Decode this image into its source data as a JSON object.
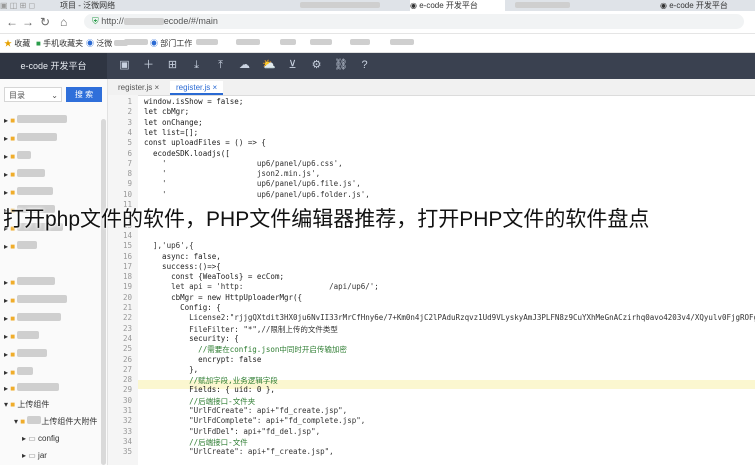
{
  "browser": {
    "tabs": [
      {
        "label": "项目 - 泛微网络",
        "active": false
      },
      {
        "label": "e-code 开发平台",
        "active": false
      },
      {
        "label": "e-code 开发平台",
        "active": true
      },
      {
        "label": "e-code 开发平台",
        "active": false
      }
    ],
    "url_prefix": "http://",
    "url_suffix": "ecode/#/main",
    "bookmarks": [
      "收藏",
      "手机收藏夹",
      "泛微",
      "部门工作"
    ]
  },
  "app": {
    "brand": "e-code 开发平台",
    "toolbar_icons": [
      "save-icon",
      "add-icon",
      "grid-icon",
      "download-icon",
      "upload-icon",
      "cloud-icon",
      "cloud-upload-icon",
      "cart-icon",
      "plugin-icon",
      "link-icon",
      "help-icon"
    ]
  },
  "sidebar": {
    "select_value": "目录",
    "search_label": "搜 索",
    "tree": [
      {
        "label": "",
        "icon": "folder-icon"
      },
      {
        "label": "",
        "icon": "folder-icon"
      },
      {
        "label": "",
        "icon": "folder-icon"
      },
      {
        "label": "",
        "icon": "folder-icon"
      },
      {
        "label": "",
        "icon": "folder-icon"
      },
      {
        "label": "",
        "icon": "folder-icon"
      },
      {
        "label": "",
        "icon": "folder-icon"
      },
      {
        "label": "",
        "icon": "folder-icon"
      },
      {
        "label": "",
        "icon": "folder-icon"
      },
      {
        "label": "",
        "icon": "folder-icon"
      },
      {
        "label": "",
        "icon": "folder-icon"
      },
      {
        "label": "",
        "icon": "folder-icon"
      },
      {
        "label": "",
        "icon": "folder-icon"
      },
      {
        "label": "",
        "icon": "folder-icon"
      },
      {
        "label": "",
        "icon": "folder-icon"
      },
      {
        "label": "上传组件",
        "icon": "folder-icon"
      },
      {
        "label": "上传组件大附件",
        "icon": "folder-icon"
      },
      {
        "label": "config",
        "icon": "folder-icon"
      },
      {
        "label": "jar",
        "icon": "folder-icon"
      }
    ]
  },
  "editor": {
    "tabs": [
      {
        "label": "register.js"
      },
      {
        "label": "register.js"
      }
    ],
    "line_numbers": [
      "1",
      "2",
      "3",
      "4",
      "5",
      "6",
      "7",
      "8",
      "9",
      "10",
      "11",
      "12",
      "13",
      "14",
      "15",
      "16",
      "17",
      "18",
      "19",
      "20",
      "21",
      "22",
      "23",
      "24",
      "25",
      "26",
      "27",
      "28",
      "29",
      "30",
      "31",
      "32",
      "33",
      "34",
      "35"
    ],
    "lines": [
      "window.isShow = false;",
      "let cbMgr;",
      "let onChange;",
      "let list=[];",
      "const uploadFiles = () => {",
      "  ecodeSDK.loadjs([",
      "    '                    up6/panel/up6.css',",
      "    '                    json2.min.js',",
      "    '                    up6/panel/up6.file.js',",
      "    '                    up6/panel/up6.folder.js',",
      "",
      "",
      "",
      "",
      "  ],'up6',{",
      "    async: false,",
      "    success:()=>{",
      "      const {WeaTools} = ecCom;",
      "      let api = 'http:                   /api/up6/';",
      "      cbMgr = new HttpUploaderMgr({",
      "        Config: {",
      "          License2:\"rjjgQXtdit3HX0ju6NvII33rMrCfHny6e/7+Km0n4jC2lPAduRzqvz1Ud9VLyskyAmJ3PLFN8z9CuYXhMeGnACzirhq0avo4203v4/XQyulv0FjgROFgziWQtB",
      "          FileFilter: \"*\",//限制上传的文件类型",
      "          security: {",
      "            //需要在config.json中同时开启传输加密",
      "            encrypt: false",
      "          },",
      "          //赋加字段,业务逻辑字段",
      "          Fields: { uid: 0 },",
      "          //后端接口-文件夹",
      "          \"UrlFdCreate\": api+\"fd_create.jsp\",",
      "          \"UrlFdComplete\": api+\"fd_complete.jsp\",",
      "          \"UrlFdDel\": api+\"fd_del.jsp\",",
      "          //后端接口-文件",
      "          \"UrlCreate\": api+\"f_create.jsp\",",
      "          \"UrlPost\": api+\"f_post.jsp\","
    ]
  },
  "overlay_title": "打开php文件的软件，PHP文件编辑器推荐，打开PHP文件的软件盘点"
}
